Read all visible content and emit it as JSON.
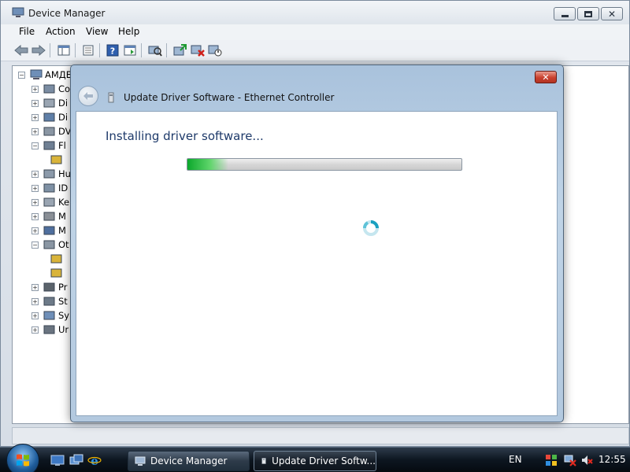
{
  "device_manager": {
    "title": "Device Manager",
    "menu": [
      "File",
      "Action",
      "View",
      "Help"
    ],
    "tree": {
      "root_label": "АМДЕ",
      "items": [
        {
          "label": "Co",
          "toggle": "+"
        },
        {
          "label": "Di",
          "toggle": "+"
        },
        {
          "label": "Di",
          "toggle": "+"
        },
        {
          "label": "DV",
          "toggle": "+"
        },
        {
          "label": "Fl",
          "toggle": "−"
        },
        {
          "label": "",
          "toggle": ""
        },
        {
          "label": "Hu",
          "toggle": "+"
        },
        {
          "label": "ID",
          "toggle": "+"
        },
        {
          "label": "Ke",
          "toggle": "+"
        },
        {
          "label": "M",
          "toggle": "+"
        },
        {
          "label": "M",
          "toggle": "+"
        },
        {
          "label": "Ot",
          "toggle": "−"
        },
        {
          "label": "",
          "toggle": ""
        },
        {
          "label": "",
          "toggle": ""
        },
        {
          "label": "Pr",
          "toggle": "+"
        },
        {
          "label": "St",
          "toggle": "+"
        },
        {
          "label": "Sy",
          "toggle": "+"
        },
        {
          "label": "Ur",
          "toggle": "+"
        }
      ]
    }
  },
  "dialog": {
    "title": "Update Driver Software - Ethernet Controller",
    "heading": "Installing driver software...",
    "progress_fraction": 0.15
  },
  "taskbar": {
    "buttons": [
      "Device Manager",
      "Update Driver Softw..."
    ],
    "language": "EN",
    "clock": "12:55"
  },
  "colors": {
    "progress_green": "#0ca82c",
    "dialog_heading": "#1e3a6a",
    "close_red": "#c9402e"
  }
}
